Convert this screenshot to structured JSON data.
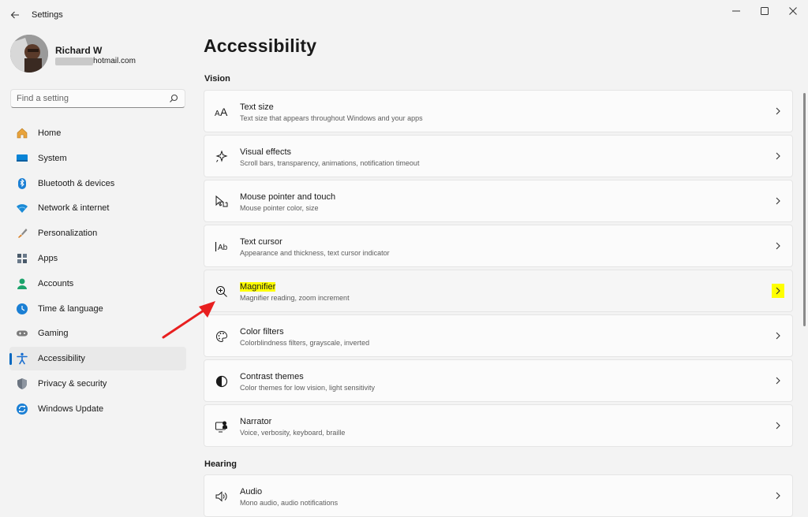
{
  "window": {
    "app_title": "Settings"
  },
  "profile": {
    "name": "Richard W",
    "email_suffix": "hotmail.com"
  },
  "search": {
    "placeholder": "Find a setting"
  },
  "nav": {
    "items": [
      {
        "label": "Home",
        "icon": "home-icon",
        "color": "#e8a33c"
      },
      {
        "label": "System",
        "icon": "system-icon",
        "color": "#0a84d6"
      },
      {
        "label": "Bluetooth & devices",
        "icon": "bluetooth-icon",
        "color": "#1a7fd4"
      },
      {
        "label": "Network & internet",
        "icon": "wifi-icon",
        "color": "#1a8ad6"
      },
      {
        "label": "Personalization",
        "icon": "brush-icon",
        "color": "#d9822b"
      },
      {
        "label": "Apps",
        "icon": "apps-icon",
        "color": "#4a5a6a"
      },
      {
        "label": "Accounts",
        "icon": "accounts-icon",
        "color": "#1ca36b"
      },
      {
        "label": "Time & language",
        "icon": "globe-clock-icon",
        "color": "#1a7fd4"
      },
      {
        "label": "Gaming",
        "icon": "gamepad-icon",
        "color": "#7a7a7a"
      },
      {
        "label": "Accessibility",
        "icon": "accessibility-icon",
        "color": "#1a6fd0"
      },
      {
        "label": "Privacy & security",
        "icon": "shield-icon",
        "color": "#6b7480"
      },
      {
        "label": "Windows Update",
        "icon": "windows-update-icon",
        "color": "#1a7fd4"
      }
    ],
    "active": "Accessibility"
  },
  "main": {
    "title": "Accessibility",
    "sections": [
      {
        "title": "Vision",
        "cards": [
          {
            "title": "Text size",
            "desc": "Text size that appears throughout Windows and your apps",
            "icon": "text-size-icon"
          },
          {
            "title": "Visual effects",
            "desc": "Scroll bars, transparency, animations, notification timeout",
            "icon": "visual-effects-icon"
          },
          {
            "title": "Mouse pointer and touch",
            "desc": "Mouse pointer color, size",
            "icon": "mouse-pointer-icon"
          },
          {
            "title": "Text cursor",
            "desc": "Appearance and thickness, text cursor indicator",
            "icon": "text-cursor-icon"
          },
          {
            "title": "Magnifier",
            "desc": "Magnifier reading, zoom increment",
            "icon": "magnifier-icon",
            "highlighted": true
          },
          {
            "title": "Color filters",
            "desc": "Colorblindness filters, grayscale, inverted",
            "icon": "palette-icon"
          },
          {
            "title": "Contrast themes",
            "desc": "Color themes for low vision, light sensitivity",
            "icon": "contrast-icon"
          },
          {
            "title": "Narrator",
            "desc": "Voice, verbosity, keyboard, braille",
            "icon": "narrator-icon"
          }
        ]
      },
      {
        "title": "Hearing",
        "cards": [
          {
            "title": "Audio",
            "desc": "Mono audio, audio notifications",
            "icon": "speaker-icon"
          }
        ]
      }
    ]
  },
  "colors": {
    "accent": "#0067c0",
    "highlight": "#ffff00",
    "annotation_arrow": "#e81f1f"
  }
}
